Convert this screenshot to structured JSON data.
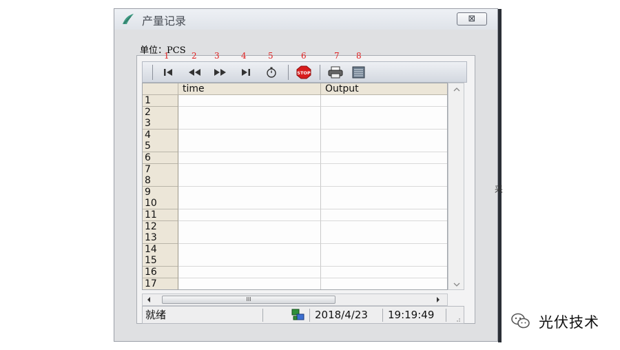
{
  "window": {
    "title": "产量记录",
    "close_glyph": "⊠",
    "icon": "app-leaf-icon"
  },
  "unit_label": "单位：PCS",
  "toolbar_numbers": [
    "1",
    "2",
    "3",
    "4",
    "5",
    "6",
    "7",
    "8"
  ],
  "toolbar_buttons": [
    {
      "icon": "first-record-icon",
      "glyph": "|◀"
    },
    {
      "icon": "previous-record-icon",
      "glyph": "◀◀"
    },
    {
      "icon": "next-record-icon",
      "glyph": "▶▶"
    },
    {
      "icon": "last-record-icon",
      "glyph": "▶|"
    },
    {
      "icon": "timer-icon",
      "glyph": "⏱"
    },
    {
      "icon": "stop-icon",
      "glyph": "STOP"
    },
    {
      "icon": "print-icon",
      "glyph": "🖶"
    },
    {
      "icon": "export-icon",
      "glyph": "▤"
    }
  ],
  "table": {
    "columns": [
      "time",
      "Output"
    ],
    "rows": [
      "1",
      "2",
      "3",
      "4",
      "5",
      "6",
      "7",
      "8",
      "9",
      "10",
      "11",
      "12",
      "13",
      "14",
      "15",
      "16",
      "17"
    ]
  },
  "hscroll_thumb_glyph": "III",
  "status": {
    "state": "就绪",
    "date": "2018/4/23",
    "time": "19:19:49",
    "network_icon": "network-icon"
  },
  "watermark": {
    "text": "光伏技术",
    "icon": "wechat-icon"
  },
  "edge_glyph": "采",
  "colors": {
    "stop_red": "#d81c1c",
    "header_beige": "#ece6d8",
    "number_red": "#e02020"
  }
}
